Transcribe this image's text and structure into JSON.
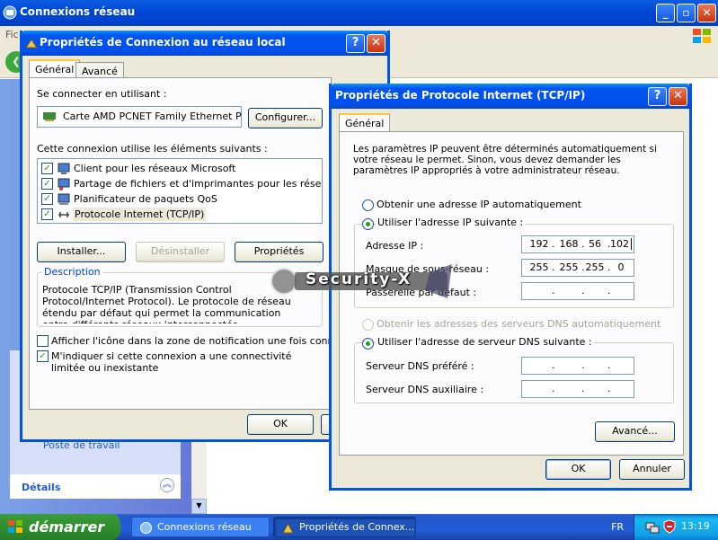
{
  "background_window": {
    "title": "Connexions réseau",
    "menu_partial": "Fic",
    "task_link": "Poste de travail",
    "details_label": "Détails"
  },
  "lan_dialog": {
    "title": "Propriétés de Connexion au réseau local",
    "tabs": [
      "Général",
      "Avancé"
    ],
    "connect_using_label": "Se connecter en utilisant :",
    "adapter_name": "Carte AMD PCNET Family Ethernet P",
    "configure_button": "Configurer...",
    "items_label": "Cette connexion utilise les éléments suivants :",
    "items": [
      {
        "label": "Client pour les réseaux Microsoft",
        "checked": true,
        "icon": "network-client-icon"
      },
      {
        "label": "Partage de fichiers et d'imprimantes pour les réseaux Mi...",
        "checked": true,
        "icon": "file-share-icon"
      },
      {
        "label": "Planificateur de paquets QoS",
        "checked": true,
        "icon": "qos-icon"
      },
      {
        "label": "Protocole Internet (TCP/IP)",
        "checked": true,
        "icon": "protocol-icon",
        "selected": true
      }
    ],
    "install_button": "Installer...",
    "uninstall_button": "Désinstaller",
    "properties_button": "Propriétés",
    "description_legend": "Description",
    "description_text": "Protocole TCP/IP (Transmission Control Protocol/Internet Protocol). Le protocole de réseau étendu par défaut qui permet la communication entre différents réseaux interconnectés.",
    "show_icon_label": "Afficher l'icône dans la zone de notification une fois connecté",
    "show_icon_checked": false,
    "notify_label": "M'indiquer si cette connexion a une connectivité limitée ou inexistante",
    "notify_checked": true,
    "ok_button": "OK"
  },
  "tcpip_dialog": {
    "title": "Propriétés de Protocole Internet (TCP/IP)",
    "tab": "Général",
    "intro": "Les paramètres IP peuvent être déterminés automatiquement si votre réseau le permet. Sinon, vous devez demander les paramètres IP appropriés à votre administrateur réseau.",
    "radio_auto_ip": "Obtenir une adresse IP automatiquement",
    "radio_manual_ip": "Utiliser l'adresse IP suivante :",
    "ip_label": "Adresse IP :",
    "ip_value": [
      "192",
      "168",
      "56",
      "102"
    ],
    "mask_label": "Masque de sous-réseau :",
    "mask_value": [
      "255",
      "255",
      "255",
      "0"
    ],
    "gateway_label": "Passerelle par défaut :",
    "gateway_value": [
      "",
      "",
      "",
      ""
    ],
    "radio_auto_dns": "Obtenir les adresses des serveurs DNS automatiquement",
    "radio_manual_dns": "Utiliser l'adresse de serveur DNS suivante :",
    "dns_pref_label": "Serveur DNS préféré :",
    "dns_pref_value": [
      "",
      "",
      "",
      ""
    ],
    "dns_alt_label": "Serveur DNS auxiliaire :",
    "dns_alt_value": [
      "",
      "",
      "",
      ""
    ],
    "advanced_button": "Avancé...",
    "ok_button": "OK",
    "cancel_button": "Annuler"
  },
  "watermark": "Security-X",
  "taskbar": {
    "start_label": "démarrer",
    "tasks": [
      "Connexions réseau",
      "Propriétés de Connex..."
    ],
    "language": "FR",
    "clock": "13:19"
  },
  "colors": {
    "titlebar_blue": "#0054e3",
    "start_green": "#2f8f2f",
    "dialog_face": "#ece9d8",
    "close_red": "#c5330f"
  }
}
